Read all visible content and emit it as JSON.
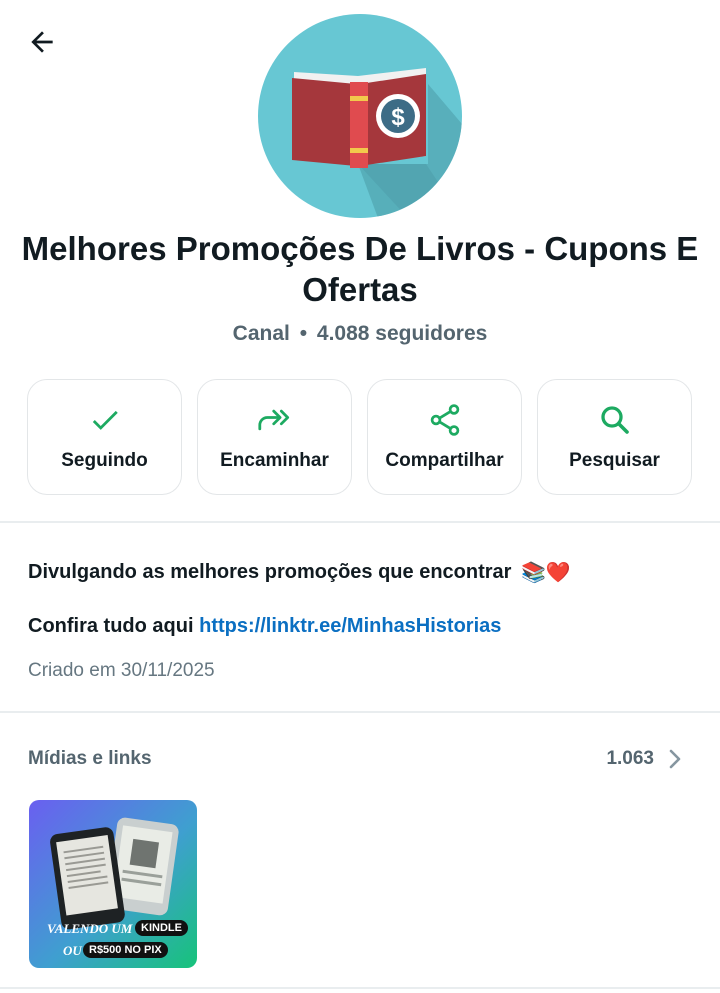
{
  "header": {
    "back_icon": "arrow-left-icon"
  },
  "channel": {
    "avatar_icon": "open-book-dollar-icon",
    "name": "Melhores Promoções De Livros - Cupons E Ofertas",
    "type": "Canal",
    "separator": "•",
    "followers": "4.088 seguidores"
  },
  "actions": [
    {
      "label": "Seguindo",
      "icon": "check-icon"
    },
    {
      "label": "Encaminhar",
      "icon": "forward-icon"
    },
    {
      "label": "Compartilhar",
      "icon": "share-icon"
    },
    {
      "label": "Pesquisar",
      "icon": "search-icon"
    }
  ],
  "about": {
    "description": "Divulgando as melhores promoções que encontrar",
    "description_emojis": "📚❤️",
    "link_prefix": "Confira tudo aqui",
    "link_text": "https://linktr.ee/MinhasHistorias",
    "created": "Criado em 30/11/2025"
  },
  "media": {
    "title": "Mídias e links",
    "count": "1.063",
    "thumbnail": {
      "line1": "VALENDO UM",
      "pill1": "KINDLE",
      "line2": "OU",
      "pill2": "R$500 NO PIX"
    }
  },
  "colors": {
    "accent": "#1daa61",
    "link": "#0b6fc2",
    "avatar_bg": "#67c7d3"
  }
}
